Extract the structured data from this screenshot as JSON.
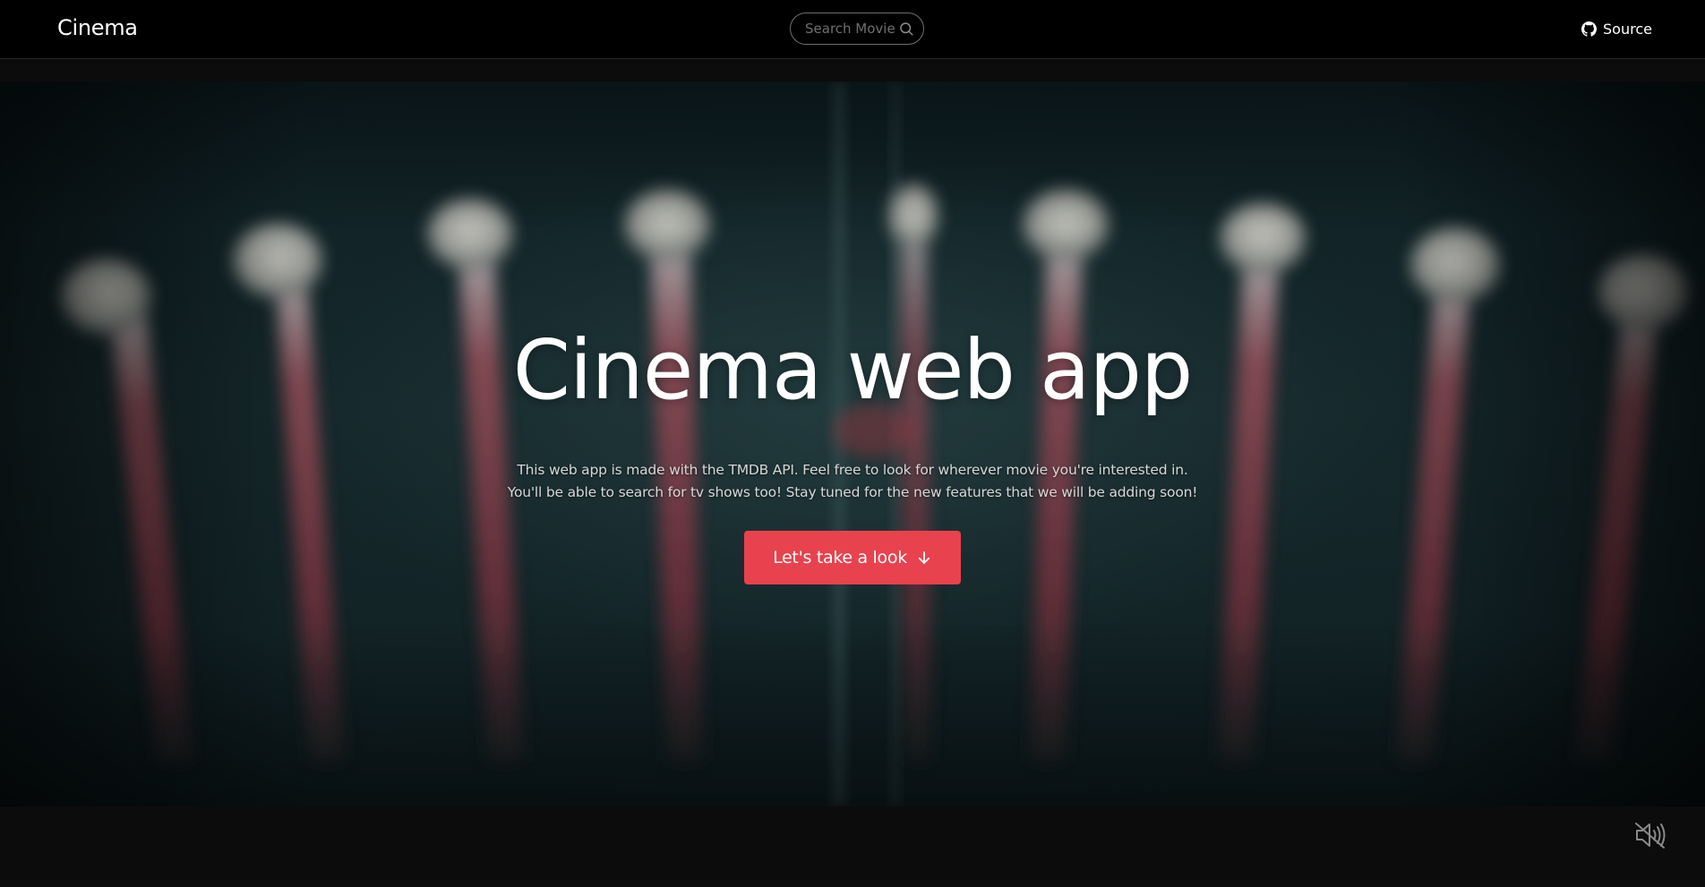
{
  "navbar": {
    "brand": "Cinema",
    "search": {
      "placeholder": "Search Movie",
      "value": "",
      "icon": "search-icon"
    },
    "source": {
      "label": "Source",
      "icon": "github-icon"
    }
  },
  "hero": {
    "title": "Cinema web app",
    "description": [
      "This web app is made with the TMDB API. Feel free to look for wherever movie you're interested in.",
      "You'll be able to search for tv shows too! Stay tuned for the new features that we will be adding soon!"
    ],
    "cta": {
      "label": "Let's take a look",
      "icon": "arrow-down-icon"
    }
  },
  "video_controls": {
    "mute_icon": "volume-muted-icon"
  },
  "colors": {
    "accent": "#e8424e",
    "navbar_bg": "#000000",
    "page_bg": "#0c0c0c",
    "text": "#ffffff"
  }
}
